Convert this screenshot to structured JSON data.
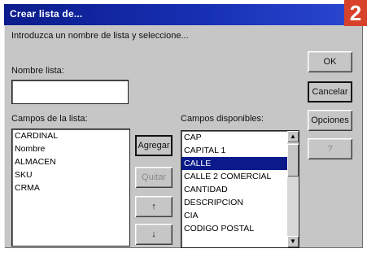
{
  "dialog": {
    "title": "Crear lista de...",
    "badge": "2",
    "instruction": "Introduzca un nombre de lista y seleccione...",
    "name_label": "Nombre lista:",
    "name_value": ""
  },
  "left_panel": {
    "label": "Campos de la lista:",
    "items": [
      "CARDINAL",
      "Nombre",
      "ALMACEN",
      "SKU",
      "CRMA"
    ]
  },
  "right_panel": {
    "label": "Campos disponibles:",
    "items": [
      "CAP",
      "CAPITAL 1",
      "CALLE",
      "CALLE 2 COMERCIAL",
      "CANTIDAD",
      "DESCRIPCION",
      "CIA",
      "CODIGO POSTAL"
    ],
    "selected_index": 2
  },
  "buttons": {
    "ok": "OK",
    "cancel": "Cancelar",
    "options": "Opciones",
    "help": "?",
    "add": "Agregar",
    "remove": "Quitar",
    "up": "↑",
    "down": "↓"
  },
  "icons": {
    "scroll_up": "▲",
    "scroll_down": "▼"
  },
  "colors": {
    "title_bar": "#0b1c8c",
    "badge": "#d8422a",
    "selection": "#0a1a8a",
    "dialog_face": "#c6c6c6"
  }
}
